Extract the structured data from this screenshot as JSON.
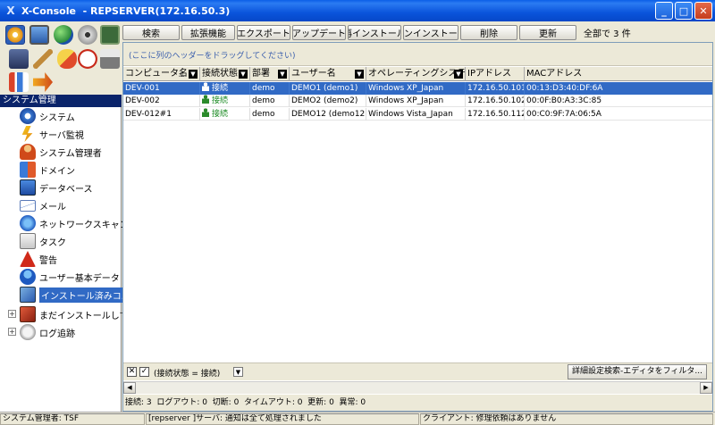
{
  "window": {
    "title": "X-Console  - REPSERVER(172.16.50.3)",
    "logo": "X",
    "min_glyph": "_",
    "max_glyph": "□",
    "close_glyph": "✕"
  },
  "toolbar": {
    "buttons": [
      {
        "label": "検索",
        "icon": "search"
      },
      {
        "label": "拡張機能",
        "icon": "extension"
      },
      {
        "label": "エクスポート",
        "icon": "export"
      },
      {
        "label": "アップデート",
        "icon": "update"
      },
      {
        "label": "再インストール",
        "icon": "reinstall"
      },
      {
        "label": "アンインストール",
        "icon": "uninstall"
      },
      {
        "label": "削除",
        "icon": "delete"
      },
      {
        "label": "更新",
        "icon": "refresh"
      }
    ],
    "count": "全部で 3 件"
  },
  "sidebar": {
    "header": "システム管理",
    "items": [
      {
        "label": "システム",
        "icon": "gear-icon"
      },
      {
        "label": "サーバ監視",
        "icon": "server-monitor-icon"
      },
      {
        "label": "システム管理者",
        "icon": "admin-user-icon"
      },
      {
        "label": "ドメイン",
        "icon": "domain-icon"
      },
      {
        "label": "データベース",
        "icon": "database-icon"
      },
      {
        "label": "メール",
        "icon": "mail-icon"
      },
      {
        "label": "ネットワークスキャン",
        "icon": "network-scan-icon"
      },
      {
        "label": "タスク",
        "icon": "task-icon"
      },
      {
        "label": "警告",
        "icon": "warning-icon"
      },
      {
        "label": "ユーザー基本データ",
        "icon": "user-data-icon"
      },
      {
        "label": "インストール済みコ...",
        "icon": "installed-icon",
        "selected": true
      },
      {
        "label": "まだインストールして...",
        "icon": "not-installed-icon",
        "expander": "+"
      },
      {
        "label": "ログ追跡",
        "icon": "log-icon",
        "expander": "+"
      }
    ]
  },
  "grid": {
    "group_hint": "(ここに列のヘッダーをドラッグしてください)",
    "columns": [
      {
        "label": "コンピュータ名",
        "sort": "△",
        "dropdown": true
      },
      {
        "label": "接続状態",
        "dropdown": true
      },
      {
        "label": "部署",
        "dropdown": true
      },
      {
        "label": "ユーザー名",
        "dropdown": true
      },
      {
        "label": "オペレーティングシステム",
        "dropdown": true
      },
      {
        "label": "IPアドレス",
        "dropdown": false
      },
      {
        "label": "MACアドレス",
        "dropdown": false
      }
    ],
    "rows": [
      {
        "computer": "DEV-001",
        "status": "接続",
        "dept": "demo",
        "user": "DEMO1 (demo1)",
        "os": "Windows XP_Japan",
        "ip": "172.16.50.101",
        "mac": "00:13:D3:40:DF:6A",
        "selected": true
      },
      {
        "computer": "DEV-002",
        "status": "接続",
        "dept": "demo",
        "user": "DEMO2 (demo2)",
        "os": "Windows XP_Japan",
        "ip": "172.16.50.102",
        "mac": "00:0F:B0:A3:3C:85",
        "selected": false
      },
      {
        "computer": "DEV-012#1",
        "status": "接続",
        "dept": "demo",
        "user": "DEMO12 (demo12)",
        "os": "Windows Vista_Japan",
        "ip": "172.16.50.112",
        "mac": "00:C0:9F:7A:06:5A",
        "selected": false
      }
    ]
  },
  "filter": {
    "clear_glyph": "✕",
    "enabled_glyph": "✓",
    "expression": "(接続状態 = 接続)",
    "dropdown_glyph": "▼",
    "editor_button": "詳細設定検索-エディタをフィルタ..."
  },
  "scroll": {
    "left": "◀",
    "right": "▶"
  },
  "summary": "接続: 3  ログアウト: 0  切断: 0  タイムアウト: 0  更新: 0  異常: 0",
  "statusbar": {
    "admin": "システム管理者: TSF",
    "server": "[repserver ]サーバ: 通知は全て処理されました",
    "client": "クライアント: 修理依頼はありません"
  }
}
